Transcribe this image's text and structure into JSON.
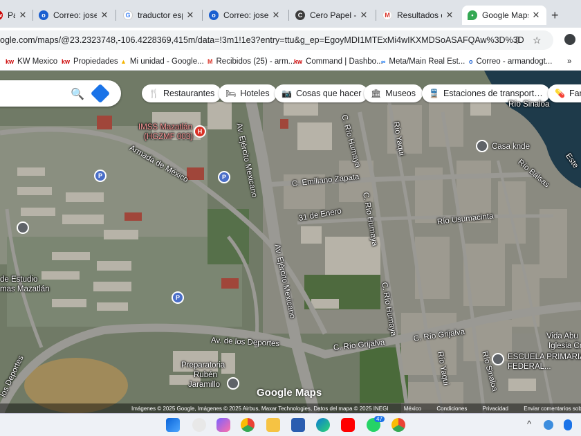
{
  "tabs": [
    {
      "title": "Pa",
      "icon": "kw-icon",
      "color": "#cc0000"
    },
    {
      "title": "Correo: jose arm",
      "icon": "outlook-icon",
      "color": "#1a5fd0"
    },
    {
      "title": "traductor espa",
      "icon": "google-icon",
      "color": "#4285f4"
    },
    {
      "title": "Correo: jose arm",
      "icon": "outlook-icon",
      "color": "#1a5fd0"
    },
    {
      "title": "Cero Papel - KW",
      "icon": "cero-papel-icon",
      "color": "#3c3c3c"
    },
    {
      "title": "Resultados de b",
      "icon": "gmail-icon",
      "color": "#d93025"
    },
    {
      "title": "Google Maps",
      "icon": "maps-pin-icon",
      "color": "#34a853"
    }
  ],
  "address_bar": {
    "url": "ogle.com/maps/@23.2323748,-106.4228369,415m/data=!3m1!1e3?entry=ttu&g_ep=EgoyMDI1MTExMi4wIKXMDSoASAFQAw%3D%3D"
  },
  "bookmarks": [
    {
      "label": "KW Mexico",
      "icon": "kw"
    },
    {
      "label": "Propiedades",
      "icon": "kw"
    },
    {
      "label": "Mi unidad - Google...",
      "icon": "drive"
    },
    {
      "label": "Recibidos (25) - arm...",
      "icon": "gmail"
    },
    {
      "label": "Command | Dashbo...",
      "icon": "kw"
    },
    {
      "label": "Meta/Main Real Est...",
      "icon": "meta"
    },
    {
      "label": "Correo - armandogt...",
      "icon": "outlook"
    }
  ],
  "chips": [
    {
      "label": "Restaurantes",
      "icon": "utensils-icon",
      "glyph": "🍴"
    },
    {
      "label": "Hoteles",
      "icon": "bed-icon",
      "glyph": "🛏"
    },
    {
      "label": "Cosas que hacer",
      "icon": "camera-icon",
      "glyph": "📷"
    },
    {
      "label": "Museos",
      "icon": "museum-icon",
      "glyph": "🏛"
    },
    {
      "label": "Estaciones de transport…",
      "icon": "train-icon",
      "glyph": "🚆"
    },
    {
      "label": "Far",
      "icon": "pharmacy-icon",
      "glyph": "💊"
    }
  ],
  "map_labels": {
    "imss": "IMSS Mazatlán",
    "imss_sub": "(HGZMF 003)",
    "armada": "Armada de México",
    "ejercito_top": "Av. Ejército Mexicano",
    "ejercito_mid": "Av. Ejército Mexicano",
    "rio_humaya_top": "C. Río Humaya",
    "rio_humaya_mid": "C. Río Humaya",
    "rio_humaya_low": "C. Río Humaya",
    "rio_yaqui": "Río Yaqui",
    "rio_yaqui_low": "Río Yaqui",
    "rio_sinaloa": "Río Sinaloa",
    "rio_sinaloa_low": "Río Sinaloa",
    "casa_knde": "Casa knde",
    "rio_balsas": "Río Balsas",
    "emiliano": "C. Emiliano Zapata",
    "enero": "31 de Enero",
    "usumacinta": "Río Usumacinta",
    "estudio1": "de Estudio",
    "estudio2": "mas Mazatlán",
    "deportes": "Av. de los Deportes",
    "deportes_left": "los Deportes",
    "grijalva1": "C. Río Grijalva",
    "grijalva2": "C. Río Grijalva",
    "vida1": "Vida Abu",
    "vida2": "Iglesia Cr",
    "escuela1": "ESCUELA PRIMARIA",
    "escuela2": "FEDERAL...",
    "prep1": "Preparatoria",
    "prep2": "Rubén",
    "prep3": "Jaramillo",
    "este": "Este"
  },
  "parking_label": "P",
  "hospital_label": "H",
  "attribution": {
    "imagery": "Imágenes © 2025 Google, Imágenes © 2025 Airbus, Maxar Technologies, Datos del mapa © 2025 INEGI",
    "country": "México",
    "terms": "Condiciones",
    "privacy": "Privacidad",
    "feedback": "Enviar comentarios sobre el p"
  },
  "google_maps_watermark": "Google Maps",
  "taskbar": {
    "whatsapp_badge": "47"
  },
  "colors": {
    "accent": "#1a73e8",
    "hospital": "#d93025"
  }
}
